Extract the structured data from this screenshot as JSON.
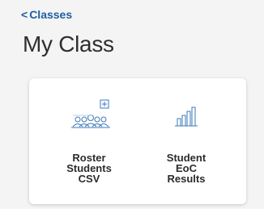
{
  "nav": {
    "back_chevron": "<",
    "back_label": "Classes"
  },
  "page": {
    "title": "My Class"
  },
  "tiles": [
    {
      "icon": "add-roster-icon",
      "lines": [
        "Roster",
        "Students",
        "CSV"
      ]
    },
    {
      "icon": "bar-chart-icon",
      "lines": [
        "Student",
        "EoC",
        "Results"
      ]
    }
  ],
  "colors": {
    "link": "#1f5fa3",
    "icon": "#3b78b8",
    "background": "#f4f4f4",
    "card": "#ffffff"
  }
}
